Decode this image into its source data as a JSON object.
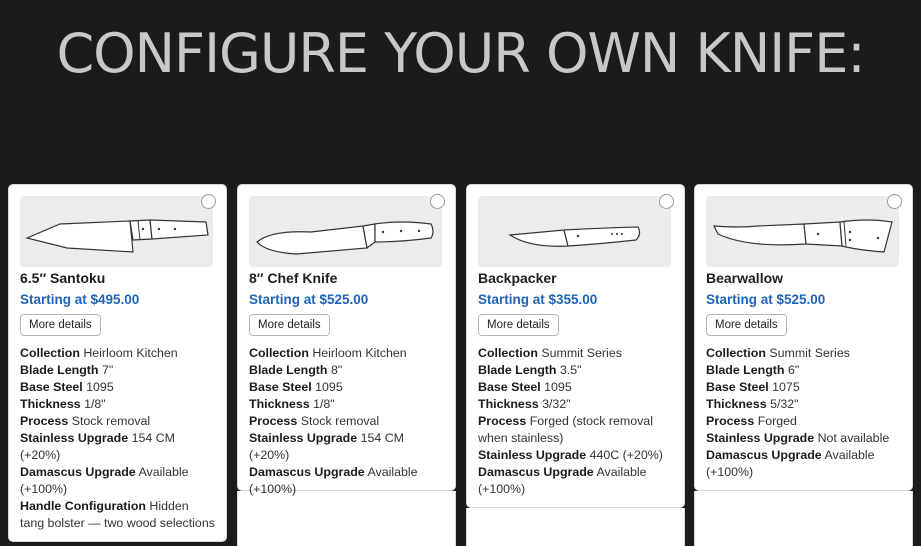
{
  "page": {
    "title": "CONFIGURE YOUR OWN KNIFE:",
    "colors": {
      "background": "#1b1b1b",
      "title": "#c8c8c8",
      "price": "#1f63b8",
      "card": "#ffffff"
    }
  },
  "knives": [
    {
      "name": "6.5″ Santoku",
      "price": "Starting at $495.00",
      "details_label": "More details",
      "image_icon": "santoku-knife-icon",
      "specs": [
        {
          "label": "Collection",
          "value": "Heirloom Kitchen"
        },
        {
          "label": "Blade Length",
          "value": "7\""
        },
        {
          "label": "Base Steel",
          "value": "1095"
        },
        {
          "label": "Thickness",
          "value": "1/8\""
        },
        {
          "label": "Process",
          "value": "Stock removal"
        },
        {
          "label": "Stainless Upgrade",
          "value": "154 CM (+20%)"
        },
        {
          "label": "Damascus Upgrade",
          "value": "Available (+100%)"
        },
        {
          "label": "Handle Configuration",
          "value": "Hidden tang bolster — two wood selections"
        }
      ]
    },
    {
      "name": "8″ Chef Knife",
      "price": "Starting at $525.00",
      "details_label": "More details",
      "image_icon": "chef-knife-icon",
      "specs": [
        {
          "label": "Collection",
          "value": "Heirloom Kitchen"
        },
        {
          "label": "Blade Length",
          "value": "8\""
        },
        {
          "label": "Base Steel",
          "value": "1095"
        },
        {
          "label": "Thickness",
          "value": "1/8\""
        },
        {
          "label": "Process",
          "value": "Stock removal"
        },
        {
          "label": "Stainless Upgrade",
          "value": "154 CM (+20%)"
        },
        {
          "label": "Damascus Upgrade",
          "value": "Available (+100%)"
        }
      ]
    },
    {
      "name": "Backpacker",
      "price": "Starting at $355.00",
      "details_label": "More details",
      "image_icon": "backpacker-knife-icon",
      "specs": [
        {
          "label": "Collection",
          "value": "Summit Series"
        },
        {
          "label": "Blade Length",
          "value": "3.5\""
        },
        {
          "label": "Base Steel",
          "value": "1095"
        },
        {
          "label": "Thickness",
          "value": "3/32\""
        },
        {
          "label": "Process",
          "value": "Forged (stock removal when stainless)"
        },
        {
          "label": "Stainless Upgrade",
          "value": "440C (+20%)"
        },
        {
          "label": "Damascus Upgrade",
          "value": "Available (+100%)"
        }
      ]
    },
    {
      "name": "Bearwallow",
      "price": "Starting at $525.00",
      "details_label": "More details",
      "image_icon": "bearwallow-knife-icon",
      "specs": [
        {
          "label": "Collection",
          "value": "Summit Series"
        },
        {
          "label": "Blade Length",
          "value": "6\""
        },
        {
          "label": "Base Steel",
          "value": "1075"
        },
        {
          "label": "Thickness",
          "value": "5/32\""
        },
        {
          "label": "Process",
          "value": "Forged"
        },
        {
          "label": "Stainless Upgrade",
          "value": "Not available"
        },
        {
          "label": "Damascus Upgrade",
          "value": "Available (+100%)"
        }
      ]
    }
  ]
}
